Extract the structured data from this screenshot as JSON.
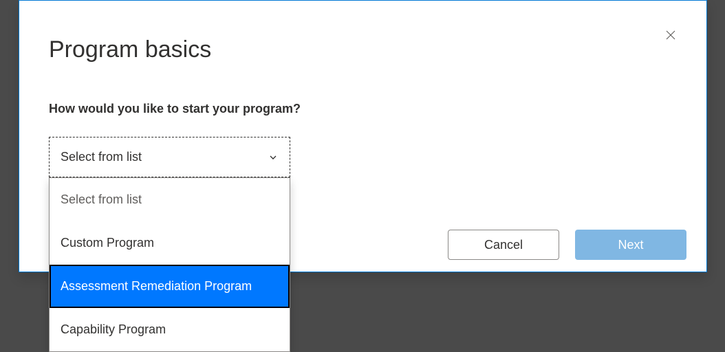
{
  "modal": {
    "title": "Program basics",
    "question": "How would you like to start your program?",
    "select": {
      "value": "Select from list",
      "options": [
        {
          "label": "Select from list",
          "placeholder": true,
          "highlighted": false
        },
        {
          "label": "Custom Program",
          "placeholder": false,
          "highlighted": false
        },
        {
          "label": "Assessment Remediation Program",
          "placeholder": false,
          "highlighted": true
        },
        {
          "label": "Capability Program",
          "placeholder": false,
          "highlighted": false
        }
      ]
    },
    "buttons": {
      "cancel": "Cancel",
      "next": "Next"
    }
  }
}
